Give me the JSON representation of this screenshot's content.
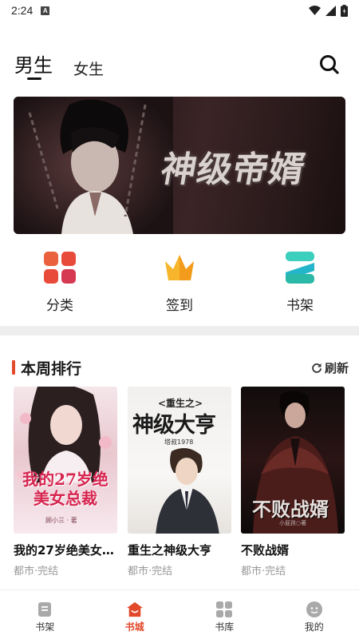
{
  "status_bar": {
    "time": "2:24",
    "notification_badge": "A"
  },
  "header": {
    "tabs": [
      {
        "label": "男生",
        "active": true
      },
      {
        "label": "女生",
        "active": false
      }
    ],
    "search_icon": "search-icon"
  },
  "banner": {
    "title": "神级帝婿"
  },
  "entries": [
    {
      "label": "分类",
      "icon": "category-icon",
      "color": "#e8563b"
    },
    {
      "label": "签到",
      "icon": "crown-icon",
      "color": "#f5a623"
    },
    {
      "label": "书架",
      "icon": "bookshelf-icon",
      "color": "#2cc1b0"
    }
  ],
  "section": {
    "title": "本周排行",
    "refresh_label": "刷新",
    "accent": "#e2492a"
  },
  "books": [
    {
      "title": "我的27岁绝美女…",
      "meta": "都市·完结",
      "cover_text": "我的27岁绝美女总裁",
      "cover_author": "顾小三 · 著"
    },
    {
      "title": "重生之神级大亨",
      "meta": "都市·完结",
      "cover_text_top": "<重生之>",
      "cover_text": "神级大亨",
      "cover_author": "塔叔1978"
    },
    {
      "title": "不败战婿",
      "meta": "都市·完结",
      "cover_text": "不败战婿",
      "cover_author": "小屁孩○著"
    }
  ],
  "bottom_nav": [
    {
      "label": "书架",
      "icon": "bookshelf-nav-icon",
      "active": false
    },
    {
      "label": "书城",
      "icon": "store-icon",
      "active": true
    },
    {
      "label": "书库",
      "icon": "library-icon",
      "active": false
    },
    {
      "label": "我的",
      "icon": "profile-icon",
      "active": false
    }
  ]
}
